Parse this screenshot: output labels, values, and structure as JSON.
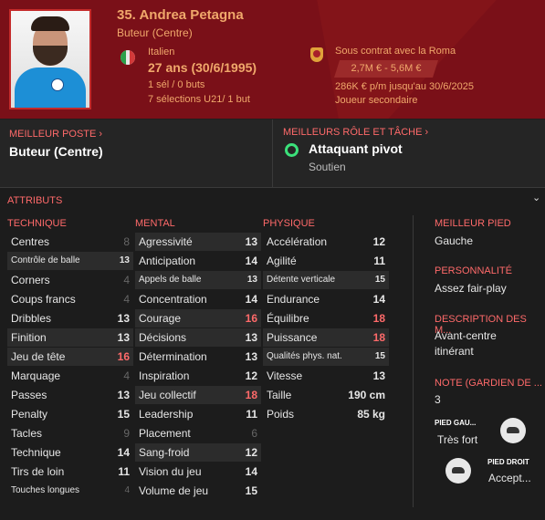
{
  "header": {
    "name": "35. Andrea Petagna",
    "role": "Buteur (Centre)",
    "nationality": "Italien",
    "age": "27 ans (30/6/1995)",
    "caps": "1 sél / 0 buts",
    "youth_caps": "7 sélections U21/ 1 but",
    "contract": "Sous contrat avec la Roma",
    "value": "2,7M € - 5,6M €",
    "wage": "286K € p/m jusqu'au 30/6/2025",
    "squad_status": "Joueur secondaire"
  },
  "positions": {
    "best_position_label": "MEILLEUR POSTE",
    "best_position": "Buteur (Centre)",
    "best_role_label": "MEILLEURS RÔLE ET TÂCHE",
    "best_role": "Attaquant pivot",
    "best_duty": "Soutien"
  },
  "attributes": {
    "title": "ATTRIBUTS",
    "technical_label": "TECHNIQUE",
    "mental_label": "MENTAL",
    "physical_label": "PHYSIQUE",
    "technical": [
      {
        "name": "Centres",
        "value": "8"
      },
      {
        "name": "Contrôle de balle",
        "value": "13"
      },
      {
        "name": "Corners",
        "value": "4"
      },
      {
        "name": "Coups francs",
        "value": "4"
      },
      {
        "name": "Dribbles",
        "value": "13"
      },
      {
        "name": "Finition",
        "value": "13"
      },
      {
        "name": "Jeu de tête",
        "value": "16"
      },
      {
        "name": "Marquage",
        "value": "4"
      },
      {
        "name": "Passes",
        "value": "13"
      },
      {
        "name": "Penalty",
        "value": "15"
      },
      {
        "name": "Tacles",
        "value": "9"
      },
      {
        "name": "Technique",
        "value": "14"
      },
      {
        "name": "Tirs de loin",
        "value": "11"
      },
      {
        "name": "Touches longues",
        "value": "4"
      }
    ],
    "mental": [
      {
        "name": "Agressivité",
        "value": "13"
      },
      {
        "name": "Anticipation",
        "value": "14"
      },
      {
        "name": "Appels de balle",
        "value": "13"
      },
      {
        "name": "Concentration",
        "value": "14"
      },
      {
        "name": "Courage",
        "value": "16"
      },
      {
        "name": "Décisions",
        "value": "13"
      },
      {
        "name": "Détermination",
        "value": "13"
      },
      {
        "name": "Inspiration",
        "value": "12"
      },
      {
        "name": "Jeu collectif",
        "value": "18"
      },
      {
        "name": "Leadership",
        "value": "11"
      },
      {
        "name": "Placement",
        "value": "6"
      },
      {
        "name": "Sang-froid",
        "value": "12"
      },
      {
        "name": "Vision du jeu",
        "value": "14"
      },
      {
        "name": "Volume de jeu",
        "value": "15"
      }
    ],
    "physical": [
      {
        "name": "Accélération",
        "value": "12"
      },
      {
        "name": "Agilité",
        "value": "11"
      },
      {
        "name": "Détente verticale",
        "value": "15"
      },
      {
        "name": "Endurance",
        "value": "14"
      },
      {
        "name": "Équilibre",
        "value": "18"
      },
      {
        "name": "Puissance",
        "value": "18"
      },
      {
        "name": "Qualités phys. nat.",
        "value": "15"
      },
      {
        "name": "Vitesse",
        "value": "13"
      },
      {
        "name": "Taille",
        "value": "190 cm"
      },
      {
        "name": "Poids",
        "value": "85 kg"
      }
    ]
  },
  "right": {
    "foot_label": "MEILLEUR PIED",
    "foot": "Gauche",
    "personality_label": "PERSONNALITÉ",
    "personality": "Assez fair-play",
    "description_label": "DESCRIPTION DES M...",
    "description_line1": "Avant-centre",
    "description_line2": "itinérant",
    "gk_label": "NOTE (GARDIEN DE ...",
    "gk": "3",
    "left_foot_label": "PIED GAU...",
    "left_foot": "Très fort",
    "right_foot_label": "PIED DROIT",
    "right_foot": "Accept..."
  },
  "colors": {
    "header_bg": "#7a1018",
    "accent": "#f0a86b",
    "label_red": "#ff6a6a",
    "best_role_dot": "#3be07a"
  }
}
